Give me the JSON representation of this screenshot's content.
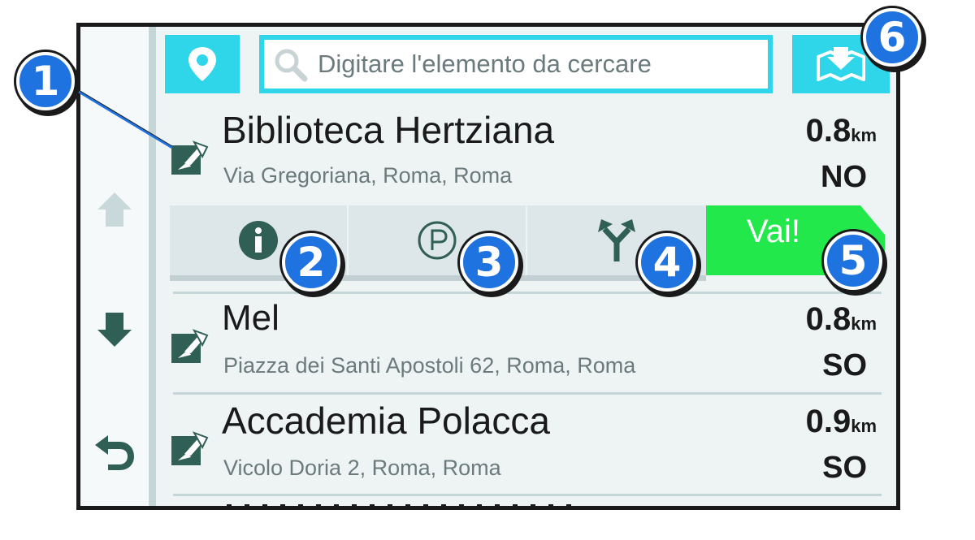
{
  "search": {
    "placeholder": "Digitare l'elemento da cercare"
  },
  "results": [
    {
      "name": "Biblioteca Hertziana",
      "address": "Via Gregoriana, Roma, Roma",
      "distance": "0.8",
      "unit": "km",
      "direction": "NO"
    },
    {
      "name": "Mel",
      "address": "Piazza dei Santi Apostoli 62, Roma, Roma",
      "distance": "0.8",
      "unit": "km",
      "direction": "SO"
    },
    {
      "name": "Accademia Polacca",
      "address": "Vicolo Doria 2, Roma, Roma",
      "distance": "0.9",
      "unit": "km",
      "direction": "SO"
    }
  ],
  "actions": {
    "go_label": "Vai!"
  },
  "callouts": [
    "1",
    "2",
    "3",
    "4",
    "5",
    "6"
  ],
  "colors": {
    "accent": "#2fd6ea",
    "go": "#22e84c",
    "callout": "#1f73e0",
    "icon": "#2f5f55"
  },
  "icons": [
    "location-pin-icon",
    "search-icon",
    "map-icon",
    "up-arrow-icon",
    "down-arrow-icon",
    "back-icon",
    "poi-icon",
    "info-icon",
    "parking-icon",
    "route-options-icon"
  ]
}
